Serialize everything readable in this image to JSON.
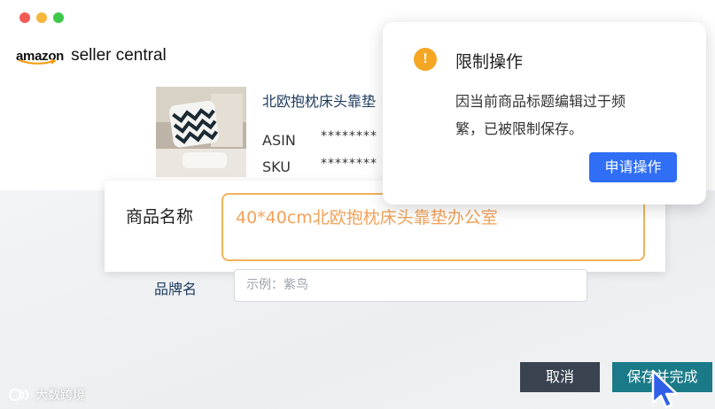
{
  "window": {
    "traffic_lights": [
      "close",
      "minimize",
      "maximize"
    ],
    "colors": {
      "close": "#f25a53",
      "minimize": "#f6b63b",
      "maximize": "#3ec849"
    }
  },
  "logo": {
    "brand": "amazon",
    "product": "seller central"
  },
  "product": {
    "title": "北欧抱枕床头靠垫",
    "asin_label": "ASIN",
    "asin_value": "********",
    "sku_label": "SKU",
    "sku_value": "********"
  },
  "form": {
    "name_label": "商品名称",
    "name_value": "40*40cm北欧抱枕床头靠垫办公室",
    "brand_label": "品牌名",
    "brand_placeholder": "示例：紫鸟"
  },
  "buttons": {
    "cancel": "取消",
    "save_and_finish": "保存并完成"
  },
  "toast": {
    "title": "限制操作",
    "message_line1": "因当前商品标题编辑过于频",
    "message_line2": "繁，已被限制保存。",
    "action": "申请操作",
    "icon": "exclamation-icon"
  },
  "watermark": {
    "text": "大数跨境"
  },
  "colors": {
    "accent_orange": "#f0b35c",
    "primary_blue": "#2f6ef5",
    "save_teal": "#1a7a88",
    "cancel_dark": "#3a4450",
    "warning": "#f5a623"
  }
}
